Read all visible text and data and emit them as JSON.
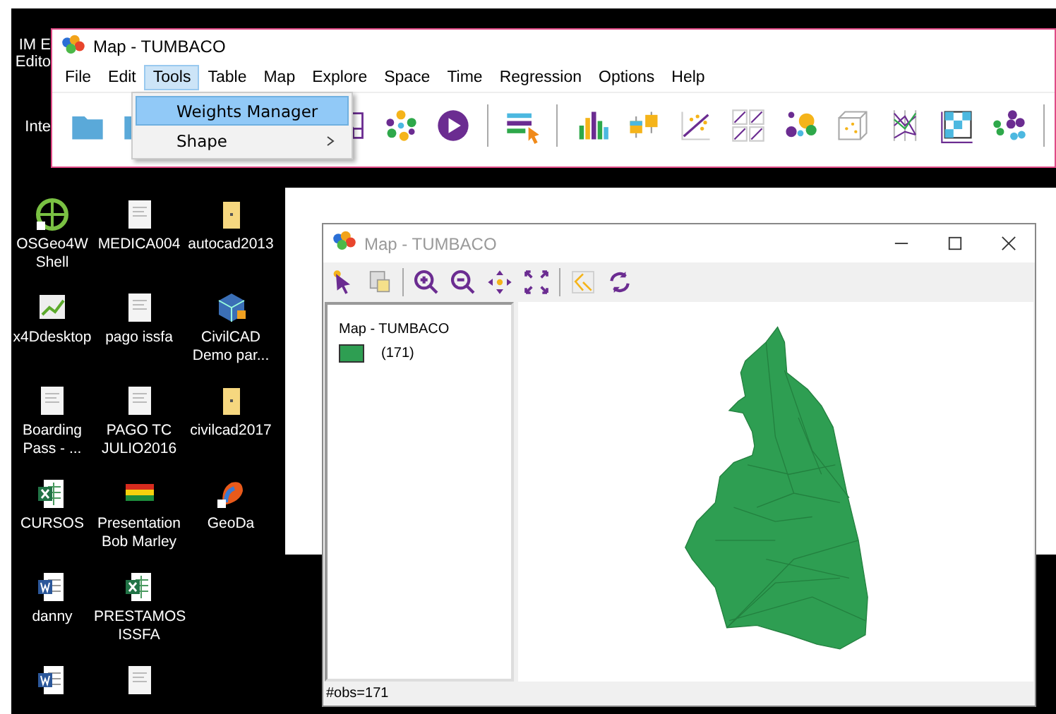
{
  "desktop": {
    "edge_labels": [
      [
        "IM E",
        "Edito"
      ],
      [
        "Inte"
      ]
    ],
    "icons": [
      {
        "kind": "osgeo",
        "label": "OSGeo4W Shell"
      },
      {
        "kind": "doc",
        "label": "MEDICA004"
      },
      {
        "kind": "folder",
        "label": "autocad2013"
      },
      {
        "kind": "chart",
        "label": "x4Ddesktop"
      },
      {
        "kind": "doc",
        "label": "pago issfa"
      },
      {
        "kind": "cube",
        "label": "CivilCAD Demo par..."
      },
      {
        "kind": "doc",
        "label": "Boarding Pass - ..."
      },
      {
        "kind": "doc",
        "label": "PAGO TC JULIO2016"
      },
      {
        "kind": "folder",
        "label": "civilcad2017"
      },
      {
        "kind": "excel",
        "label": "CURSOS"
      },
      {
        "kind": "flag",
        "label": "Presentation Bob Marley"
      },
      {
        "kind": "geoda",
        "label": "GeoDa"
      },
      {
        "kind": "word",
        "label": "danny"
      },
      {
        "kind": "excel",
        "label": "PRESTAMOS ISSFA"
      },
      {
        "kind": "none"
      },
      {
        "kind": "word"
      },
      {
        "kind": "doc"
      }
    ]
  },
  "main_window": {
    "title": "Map - TUMBACO",
    "menu": [
      {
        "label": "File",
        "selected": false
      },
      {
        "label": "Edit",
        "selected": false
      },
      {
        "label": "Tools",
        "selected": true
      },
      {
        "label": "Table",
        "selected": false
      },
      {
        "label": "Map",
        "selected": false
      },
      {
        "label": "Explore",
        "selected": false
      },
      {
        "label": "Space",
        "selected": false
      },
      {
        "label": "Time",
        "selected": false
      },
      {
        "label": "Regression",
        "selected": false
      },
      {
        "label": "Options",
        "selected": false
      },
      {
        "label": "Help",
        "selected": false
      }
    ],
    "dropdown": [
      {
        "label": "Weights Manager",
        "selected": true,
        "submenu": false
      },
      {
        "label": "Shape",
        "selected": false,
        "submenu": true
      }
    ]
  },
  "map_window": {
    "title": "Map - TUMBACO",
    "legend": {
      "title": "Map - TUMBACO",
      "items": [
        {
          "label": "(171)",
          "color": "#2e9e52"
        }
      ]
    },
    "status_bar": "#obs=171"
  }
}
